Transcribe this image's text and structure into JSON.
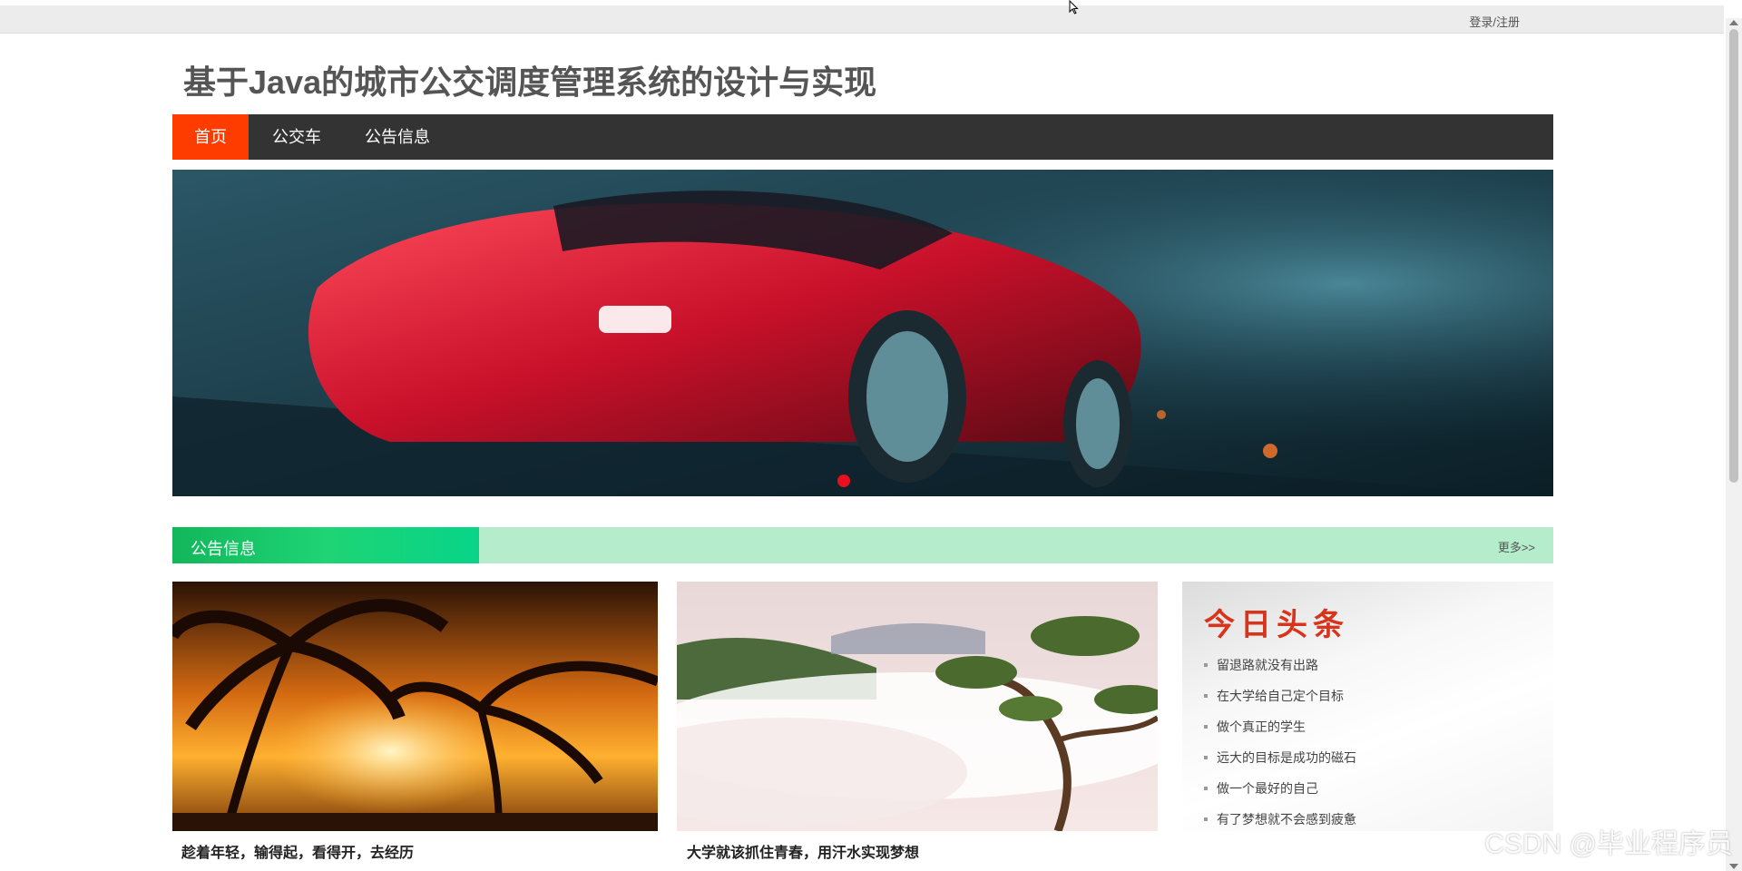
{
  "header": {
    "login_link": "登录/注册",
    "site_title": "基于Java的城市公交调度管理系统的设计与实现"
  },
  "nav": {
    "items": [
      {
        "label": "首页",
        "active": true
      },
      {
        "label": "公交车",
        "active": false
      },
      {
        "label": "公告信息",
        "active": false
      }
    ]
  },
  "banner": {
    "image": "red-sports-car",
    "active_slide": 1,
    "slide_count": 2
  },
  "section": {
    "title": "公告信息",
    "more": "更多>>"
  },
  "cards": [
    {
      "image": "palm-sunset",
      "caption": "趁着年轻，输得起，看得开，去经历"
    },
    {
      "image": "mountain-pine-clouds",
      "caption": "大学就该抓住青春，用汗水实现梦想"
    }
  ],
  "headlines": {
    "title": "今日头条",
    "items": [
      "留退路就没有出路",
      "在大学给自己定个目标",
      "做个真正的学生",
      "远大的目标是成功的磁石",
      "做一个最好的自己",
      "有了梦想就不会感到疲惫"
    ]
  },
  "watermark": "CSDN @毕业程序员",
  "colors": {
    "nav_bg": "#333333",
    "nav_active": "#ff3c00",
    "section_bar": "#b4eccc",
    "section_title_bg": "#12b75a",
    "headline_title": "#d8341b",
    "active_dot": "#e8101e"
  }
}
